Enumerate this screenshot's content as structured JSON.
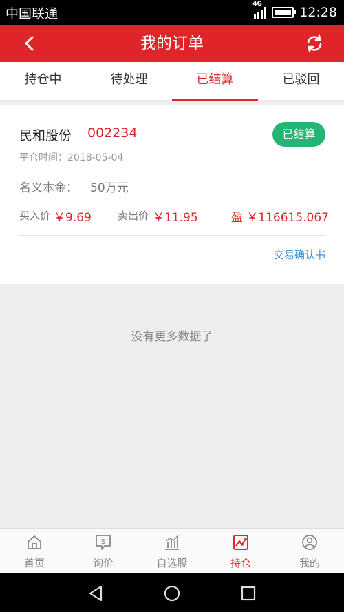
{
  "status_bar": {
    "carrier": "中国联通",
    "network": "4G",
    "time": "12:28"
  },
  "header": {
    "title": "我的订单"
  },
  "tabs": [
    {
      "label": "持仓中",
      "active": false
    },
    {
      "label": "待处理",
      "active": false
    },
    {
      "label": "已结算",
      "active": true
    },
    {
      "label": "已驳回",
      "active": false
    }
  ],
  "order": {
    "stock_name": "民和股份",
    "stock_code": "002234",
    "status_badge": "已结算",
    "close_time": "平仓时间：2018-05-04",
    "notional_label": "名义本金：",
    "notional_value": "50万元",
    "buy_label": "买入价",
    "buy_price": "￥9.69",
    "sell_label": "卖出价",
    "sell_price": "￥11.95",
    "profit": "盈 ￥116615.067",
    "confirm_link": "交易确认书"
  },
  "no_more_text": "没有更多数据了",
  "bottom_tabs": [
    {
      "label": "首页",
      "icon": "home-icon",
      "active": false
    },
    {
      "label": "询价",
      "icon": "quote-icon",
      "active": false
    },
    {
      "label": "自选股",
      "icon": "watchlist-icon",
      "active": false
    },
    {
      "label": "持仓",
      "icon": "position-icon",
      "active": true
    },
    {
      "label": "我的",
      "icon": "profile-icon",
      "active": false
    }
  ],
  "colors": {
    "brand_red": "#e0252a",
    "badge_green": "#22b573",
    "link_blue": "#3a8fd8"
  }
}
